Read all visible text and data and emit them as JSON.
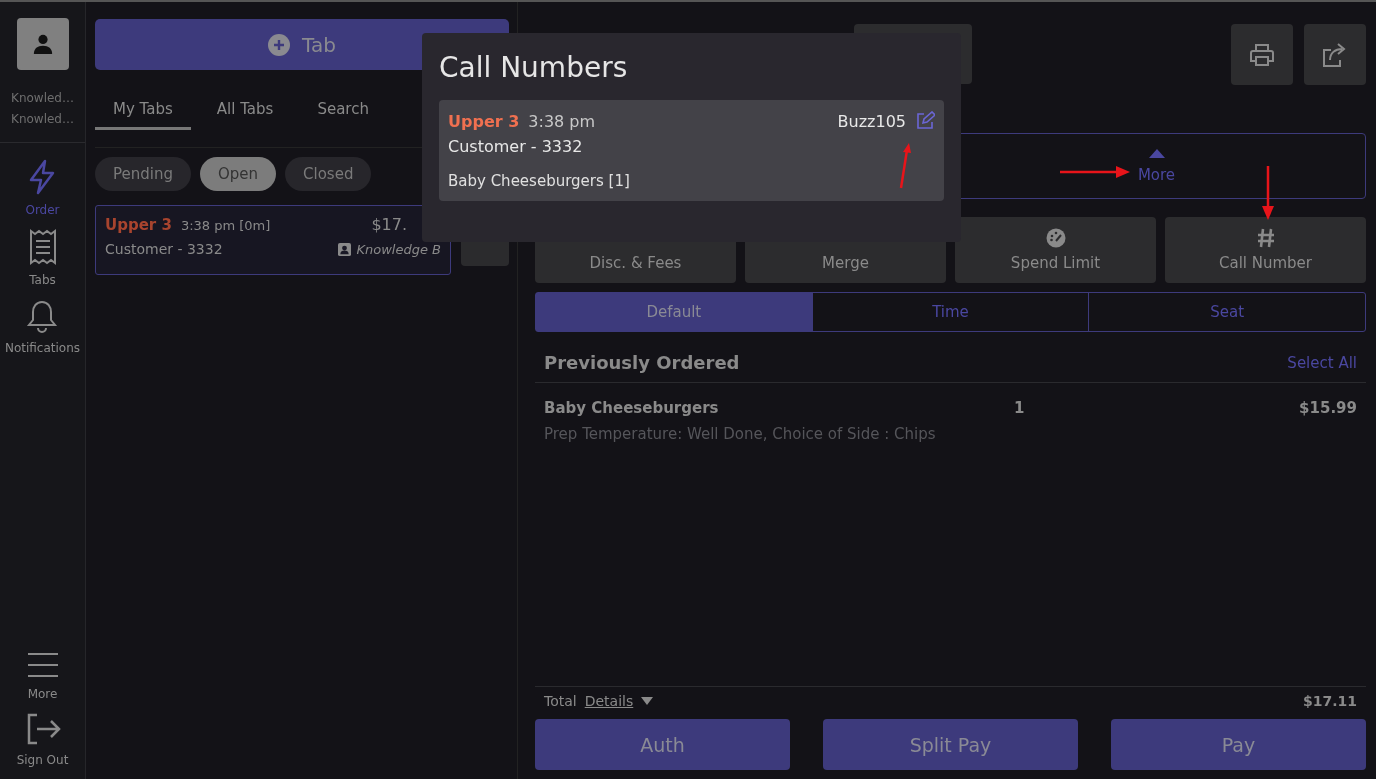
{
  "sidebar": {
    "user_lines": [
      "Knowled…",
      "Knowled…"
    ],
    "nav": [
      {
        "label": "Order",
        "kind": "bolt",
        "selected": true
      },
      {
        "label": "Tabs",
        "kind": "receipt",
        "selected": false
      },
      {
        "label": "Notifications",
        "kind": "bell",
        "selected": false
      }
    ],
    "bottom": [
      {
        "label": "More",
        "kind": "menu"
      },
      {
        "label": "Sign Out",
        "kind": "signout"
      }
    ]
  },
  "tabs_panel": {
    "new_tab_button": "Tab",
    "tabs": [
      {
        "label": "My Tabs",
        "selected": true
      },
      {
        "label": "All Tabs",
        "selected": false
      },
      {
        "label": "Search",
        "selected": false
      }
    ],
    "filters": [
      {
        "label": "Pending",
        "selected": false
      },
      {
        "label": "Open",
        "selected": true
      },
      {
        "label": "Closed",
        "selected": false
      }
    ],
    "cards": [
      {
        "name": "Upper 3",
        "time": "3:38 pm [0m]",
        "amount": "$17.",
        "customer": "Customer - 3332",
        "server": "Knowledge B"
      }
    ]
  },
  "order": {
    "more": "More",
    "actions": [
      {
        "label": "Disc. & Fees",
        "kind": "none"
      },
      {
        "label": "Merge",
        "kind": "none"
      },
      {
        "label": "Spend Limit",
        "kind": "gauge"
      },
      {
        "label": "Call Number",
        "kind": "hash"
      }
    ],
    "views": [
      {
        "label": "Default",
        "selected": true
      },
      {
        "label": "Time",
        "selected": false
      },
      {
        "label": "Seat",
        "selected": false
      }
    ],
    "section_title": "Previously Ordered",
    "select_all": "Select All",
    "items": [
      {
        "name": "Baby Cheeseburgers",
        "qty": "1",
        "price": "$15.99",
        "mods": "Prep Temperature: Well Done, Choice of Side : Chips"
      }
    ],
    "total_label": "Total",
    "details": "Details",
    "total": "$17.11",
    "buttons": [
      "Auth",
      "Split Pay",
      "Pay"
    ]
  },
  "popup": {
    "title": "Call Numbers",
    "entries": [
      {
        "name": "Upper 3",
        "time": "3:38 pm",
        "call_number": "Buzz105",
        "customer": "Customer - 3332",
        "items": "Baby Cheeseburgers [1]"
      }
    ]
  }
}
